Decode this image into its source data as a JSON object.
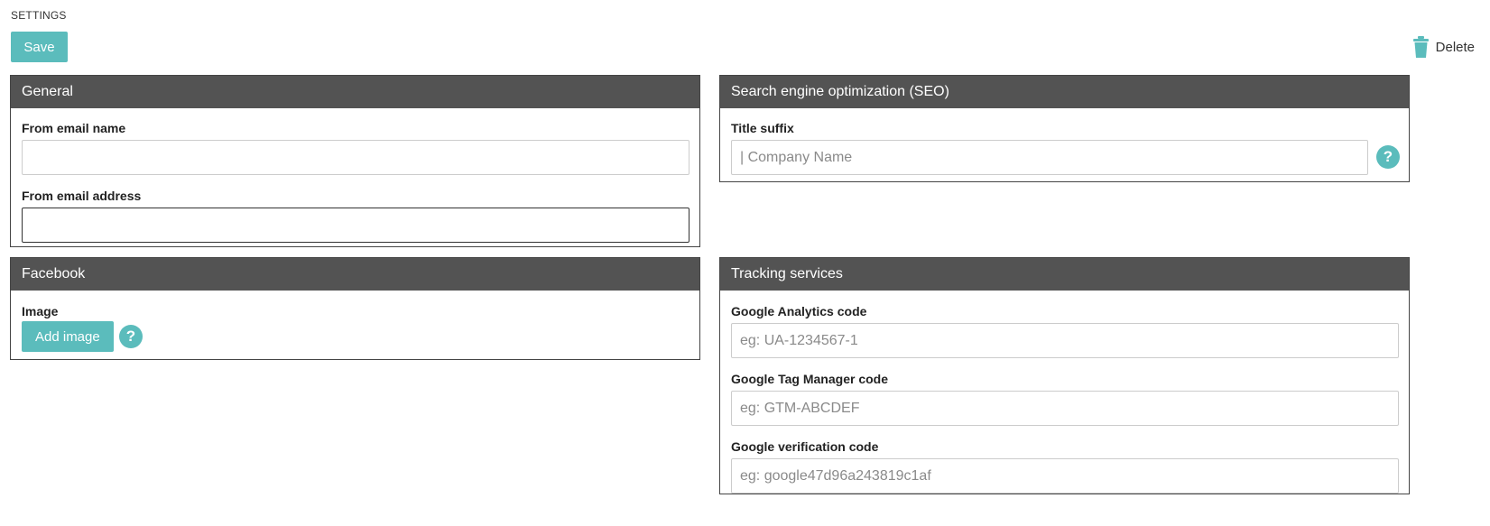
{
  "page": {
    "title": "SETTINGS"
  },
  "toolbar": {
    "save_label": "Save",
    "delete_label": "Delete"
  },
  "general": {
    "header": "General",
    "from_name_label": "From email name",
    "from_name_value": "",
    "from_address_label": "From email address",
    "from_address_value": ""
  },
  "seo": {
    "header": "Search engine optimization (SEO)",
    "title_suffix_label": "Title suffix",
    "title_suffix_placeholder": "| Company Name",
    "help_glyph": "?"
  },
  "facebook": {
    "header": "Facebook",
    "image_label": "Image",
    "add_image_label": "Add image",
    "help_glyph": "?"
  },
  "tracking": {
    "header": "Tracking services",
    "ga_label": "Google Analytics code",
    "ga_placeholder": "eg: UA-1234567-1",
    "gtm_label": "Google Tag Manager code",
    "gtm_placeholder": "eg: GTM-ABCDEF",
    "verification_label": "Google verification code",
    "verification_placeholder": "eg: google47d96a243819c1af"
  },
  "colors": {
    "accent": "#5bbcbc",
    "panel_header": "#535353"
  },
  "icons": {
    "delete": "trash-icon",
    "help": "help-icon"
  }
}
